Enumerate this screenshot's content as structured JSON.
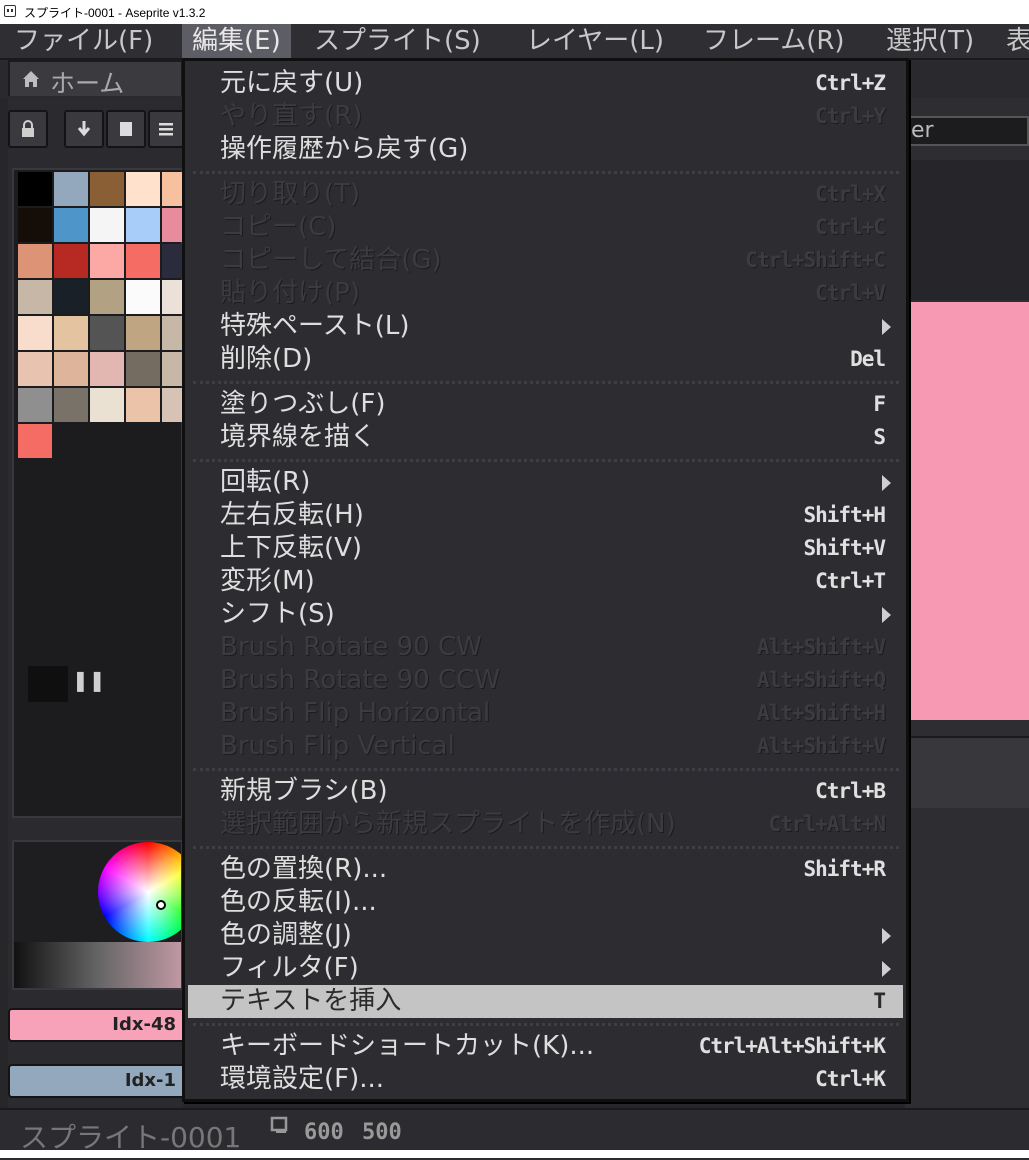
{
  "window": {
    "title": "スプライト-0001 - Aseprite v1.3.2"
  },
  "menubar": [
    "ファイル(F)",
    "編集(E)",
    "スプライト(S)",
    "レイヤー(L)",
    "フレーム(R)",
    "選択(T)",
    "表"
  ],
  "tabs": {
    "home": "ホーム"
  },
  "right_panel": {
    "field_text": "er"
  },
  "color_bars": {
    "fg": "Idx-48",
    "bg": "Idx-1"
  },
  "status": {
    "sprite_name": "スプライト-0001",
    "width": "600",
    "height": "500"
  },
  "palette_colors": [
    "#000000",
    "#93a8bd",
    "#8a5f36",
    "#ffe1cc",
    "#f7c1a0",
    "#140d08",
    "#4e96c9",
    "#f5f5f5",
    "#a7cdf8",
    "#e88b9c",
    "#dd9476",
    "#b72a23",
    "#fca8a5",
    "#f46c64",
    "#2a2c3d",
    "#c7b7a6",
    "#1a2028",
    "#b3a183",
    "#fbfbfb",
    "#ece1d8",
    "#f8dccc",
    "#e4c3a0",
    "#545454",
    "#c0a583",
    "#c7b7a6",
    "#e8c4b0",
    "#deb49a",
    "#e2b6b1",
    "#756c61",
    "#c7b7a6",
    "#8f8f8f",
    "#787268",
    "#ebe1d2",
    "#ebc3a8",
    "#d7c3b6",
    "#f46c64"
  ],
  "edit_menu": {
    "items": [
      {
        "label": "元に戻す(U)",
        "shortcut": "Ctrl+Z",
        "enabled": true
      },
      {
        "label": "やり直す(R)",
        "shortcut": "Ctrl+Y",
        "enabled": false
      },
      {
        "label": "操作履歴から戻す(G)",
        "shortcut": "",
        "enabled": true
      },
      {
        "label": "切り取り(T)",
        "shortcut": "Ctrl+X",
        "enabled": false
      },
      {
        "label": "コピー(C)",
        "shortcut": "Ctrl+C",
        "enabled": false
      },
      {
        "label": "コピーして結合(G)",
        "shortcut": "Ctrl+Shift+C",
        "enabled": false
      },
      {
        "label": "貼り付け(P)",
        "shortcut": "Ctrl+V",
        "enabled": false
      },
      {
        "label": "特殊ペースト(L)",
        "shortcut": "",
        "enabled": true,
        "submenu": true
      },
      {
        "label": "削除(D)",
        "shortcut": "Del",
        "enabled": true
      },
      {
        "label": "塗りつぶし(F)",
        "shortcut": "F",
        "enabled": true
      },
      {
        "label": "境界線を描く",
        "shortcut": "S",
        "enabled": true
      },
      {
        "label": "回転(R)",
        "shortcut": "",
        "enabled": true,
        "submenu": true
      },
      {
        "label": "左右反転(H)",
        "shortcut": "Shift+H",
        "enabled": true
      },
      {
        "label": "上下反転(V)",
        "shortcut": "Shift+V",
        "enabled": true
      },
      {
        "label": "変形(M)",
        "shortcut": "Ctrl+T",
        "enabled": true
      },
      {
        "label": "シフト(S)",
        "shortcut": "",
        "enabled": true,
        "submenu": true
      },
      {
        "label": "Brush Rotate 90 CW",
        "shortcut": "Alt+Shift+V",
        "enabled": false
      },
      {
        "label": "Brush Rotate 90 CCW",
        "shortcut": "Alt+Shift+Q",
        "enabled": false
      },
      {
        "label": "Brush Flip Horizontal",
        "shortcut": "Alt+Shift+H",
        "enabled": false
      },
      {
        "label": "Brush Flip Vertical",
        "shortcut": "Alt+Shift+V",
        "enabled": false
      },
      {
        "label": "新規ブラシ(B)",
        "shortcut": "Ctrl+B",
        "enabled": true
      },
      {
        "label": "選択範囲から新規スプライトを作成(N)",
        "shortcut": "Ctrl+Alt+N",
        "enabled": false
      },
      {
        "label": "色の置換(R)...",
        "shortcut": "Shift+R",
        "enabled": true
      },
      {
        "label": "色の反転(I)...",
        "shortcut": "",
        "enabled": true
      },
      {
        "label": "色の調整(J)",
        "shortcut": "",
        "enabled": true,
        "submenu": true
      },
      {
        "label": "フィルタ(F)",
        "shortcut": "",
        "enabled": true,
        "submenu": true
      },
      {
        "label": "テキストを挿入",
        "shortcut": "T",
        "enabled": true,
        "highlighted": true
      },
      {
        "label": "キーボードショートカット(K)...",
        "shortcut": "Ctrl+Alt+Shift+K",
        "enabled": true
      },
      {
        "label": "環境設定(F)...",
        "shortcut": "Ctrl+K",
        "enabled": true
      }
    ]
  }
}
